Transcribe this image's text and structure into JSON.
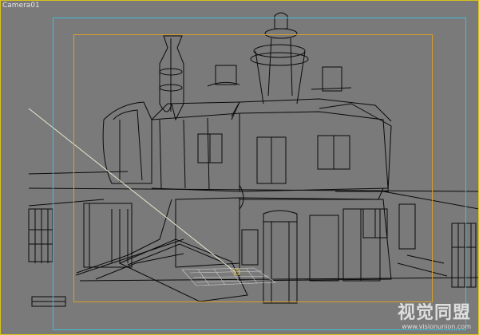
{
  "viewport": {
    "label": "Camera01",
    "border_color": "#d8c21a",
    "background_color": "#7a7a7a"
  },
  "frames": {
    "safe_frame_color": "#3fbfd6",
    "render_frame_color": "#d7a02a"
  },
  "scene": {
    "wire_color": "#0a0a0a",
    "camera_line_color": "#e8e8d0",
    "grid_color": "#cfcfcf",
    "pivot_color": "#e0c040"
  },
  "watermark": {
    "main": "视觉同盟",
    "url": "www.visionunion.com"
  }
}
